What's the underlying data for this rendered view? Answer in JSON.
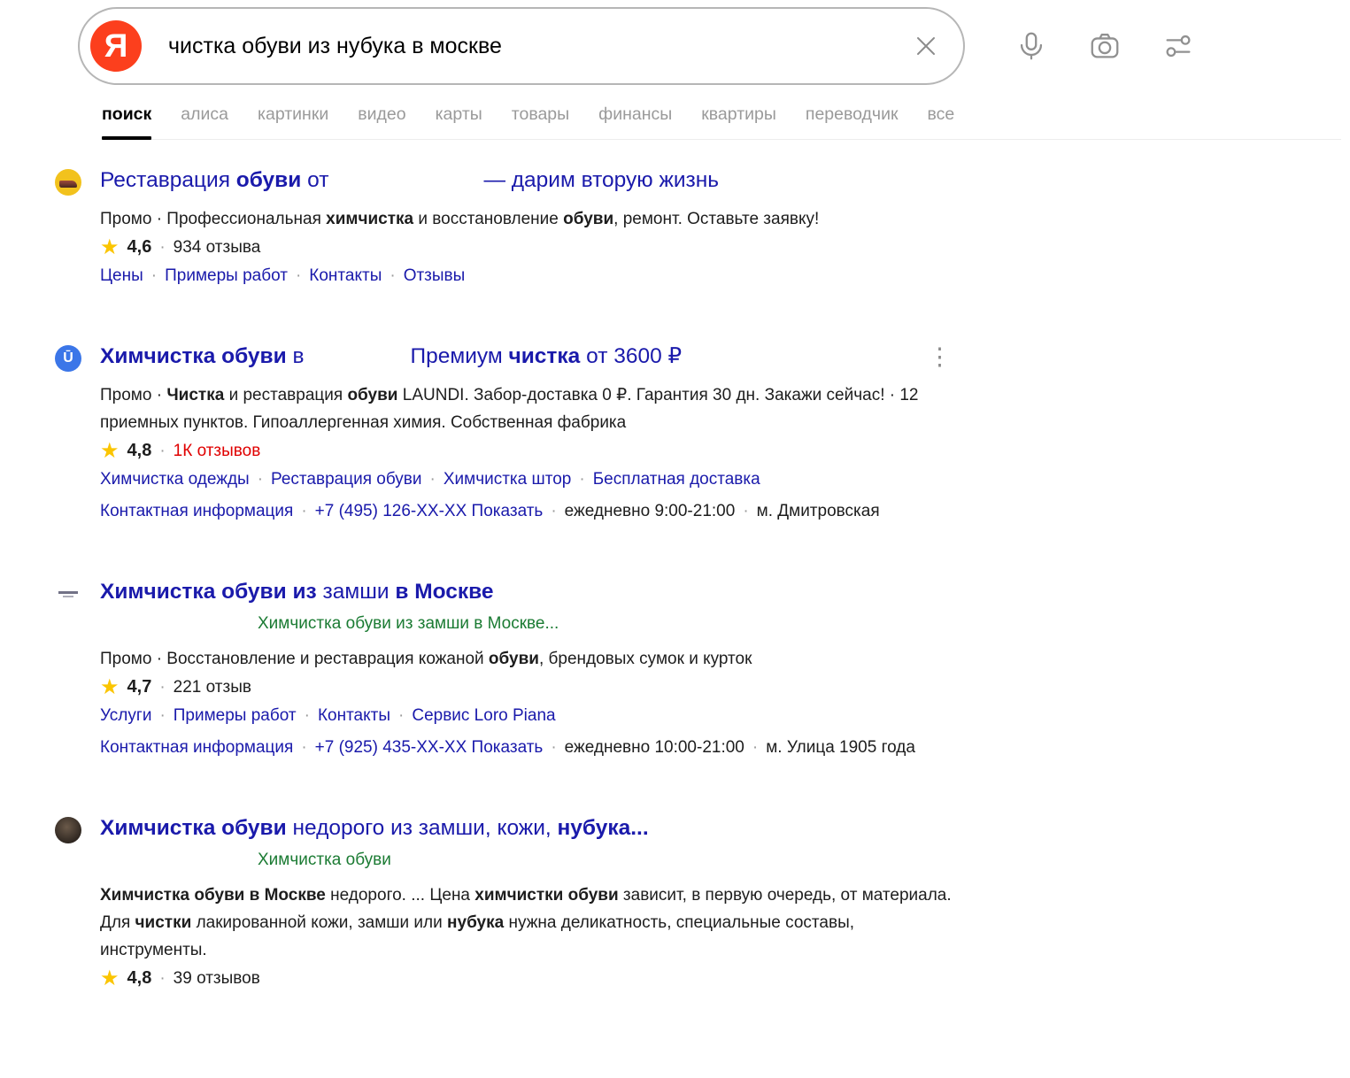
{
  "colors": {
    "accent_red": "#fc3f1d",
    "title_blue": "#1a1aab",
    "breadcrumb_green": "#1b7b33",
    "review_red": "#e00000",
    "star_yellow": "#fbc500"
  },
  "search_bar": {
    "logo_letter": "Я",
    "query": "чистка обуви из нубука в москве",
    "icons": [
      "clear-icon",
      "mic-icon",
      "camera-icon",
      "filters-icon"
    ]
  },
  "tabs": [
    {
      "id": "poisk",
      "label": "поиск",
      "active": true
    },
    {
      "id": "alisa",
      "label": "алиса"
    },
    {
      "id": "kartinki",
      "label": "картинки"
    },
    {
      "id": "video",
      "label": "видео"
    },
    {
      "id": "karty",
      "label": "карты"
    },
    {
      "id": "tovary",
      "label": "товары"
    },
    {
      "id": "finansy",
      "label": "финансы"
    },
    {
      "id": "kvartiry",
      "label": "квартиры"
    },
    {
      "id": "perevodchik",
      "label": "переводчик"
    },
    {
      "id": "vse",
      "label": "все"
    }
  ],
  "results": [
    {
      "favicon": {
        "cls": "fav-restorer",
        "name": "shoe-restoration-favicon-icon"
      },
      "title": [
        {
          "t": "Реставрация "
        },
        {
          "t": "обуви",
          "b": true
        },
        {
          "t": " от"
        },
        {
          "gap": 175
        },
        {
          "t": "— дарим вторую жизнь"
        }
      ],
      "snippet": [
        {
          "t": "Промо · Профессиональная "
        },
        {
          "t": "химчистка",
          "b": true
        },
        {
          "t": " и восстановление "
        },
        {
          "t": "обуви",
          "b": true
        },
        {
          "t": ", ремонт. Оставьте заявку!"
        }
      ],
      "rating": {
        "value": "4,6",
        "count": "934 отзыва",
        "count_red": false
      },
      "link_rows": [
        [
          {
            "t": "Цены",
            "link": true
          },
          {
            "t": "Примеры работ",
            "link": true
          },
          {
            "t": "Контакты",
            "link": true
          },
          {
            "t": "Отзывы",
            "link": true
          }
        ]
      ],
      "menu": false
    },
    {
      "favicon": {
        "cls": "fav-laundi",
        "name": "laundi-logo-favicon-icon",
        "letter": "Ū"
      },
      "title": [
        {
          "t": "Химчистка обуви",
          "b": true
        },
        {
          "t": " в"
        },
        {
          "gap": 120
        },
        {
          "t": "Премиум "
        },
        {
          "t": "чистка",
          "b": true
        },
        {
          "t": " от 3600 ₽"
        }
      ],
      "snippet": [
        {
          "t": "Промо · "
        },
        {
          "t": "Чистка",
          "b": true
        },
        {
          "t": " и реставрация "
        },
        {
          "t": "обуви",
          "b": true
        },
        {
          "t": " LAUNDI. Забор-доставка 0 ₽. Гарантия 30 дн. Закажи сейчас! · 12 приемных пунктов. Гипоаллергенная химия. Собственная фабрика"
        }
      ],
      "rating": {
        "value": "4,8",
        "count": "1К отзывов",
        "count_red": true
      },
      "link_rows": [
        [
          {
            "t": "Химчистка одежды",
            "link": true
          },
          {
            "t": "Реставрация обуви",
            "link": true
          },
          {
            "t": "Химчистка штор",
            "link": true
          },
          {
            "t": "Бесплатная доставка",
            "link": true
          }
        ],
        [
          {
            "t": "Контактная информация",
            "link": true
          },
          {
            "t": "+7 (495) 126-XX-XX Показать",
            "link": true
          },
          {
            "t": "ежедневно 9:00-21:00",
            "link": false
          },
          {
            "t": "м. Дмитровская",
            "link": false
          }
        ]
      ],
      "menu": true
    },
    {
      "favicon": {
        "cls": "fav-textlogo",
        "name": "text-logo-favicon-icon"
      },
      "title": [
        {
          "t": "Химчистка обуви из",
          "b": true
        },
        {
          "t": " замши "
        },
        {
          "t": "в Москве",
          "b": true
        }
      ],
      "breadcrumb": "Химчистка обуви из замши в Москве...",
      "breadcrumb_indent": 178,
      "snippet": [
        {
          "t": "Промо · Восстановление и реставрация кожаной "
        },
        {
          "t": "обуви",
          "b": true
        },
        {
          "t": ", брендовых сумок и курток"
        }
      ],
      "rating": {
        "value": "4,7",
        "count": "221 отзыв",
        "count_red": false
      },
      "link_rows": [
        [
          {
            "t": "Услуги",
            "link": true
          },
          {
            "t": "Примеры работ",
            "link": true
          },
          {
            "t": "Контакты",
            "link": true
          },
          {
            "t": "Сервис Loro Piana",
            "link": true
          }
        ],
        [
          {
            "t": "Контактная информация",
            "link": true
          },
          {
            "t": "+7 (925) 435-XX-XX Показать",
            "link": true
          },
          {
            "t": "ежедневно 10:00-21:00",
            "link": false
          },
          {
            "t": "м. Улица 1905 года",
            "link": false
          }
        ]
      ],
      "menu": false
    },
    {
      "favicon": {
        "cls": "fav-dark",
        "name": "dark-photo-favicon-icon"
      },
      "title": [
        {
          "t": "Химчистка обуви",
          "b": true
        },
        {
          "t": " недорого из замши, кожи, "
        },
        {
          "t": "нубука...",
          "b": true
        }
      ],
      "breadcrumb": "Химчистка обуви",
      "breadcrumb_indent": 178,
      "snippet": [
        {
          "t": "Химчистка обуви в Москве",
          "b": true
        },
        {
          "t": " недорого. ... Цена "
        },
        {
          "t": "химчистки обуви",
          "b": true
        },
        {
          "t": " зависит, в первую очередь, от материала. Для "
        },
        {
          "t": "чистки",
          "b": true
        },
        {
          "t": " лакированной кожи, замши или "
        },
        {
          "t": "нубука",
          "b": true
        },
        {
          "t": " нужна деликатность, специальные составы, инструменты."
        }
      ],
      "rating": {
        "value": "4,8",
        "count": "39 отзывов",
        "count_red": false
      },
      "link_rows": [],
      "menu": false
    }
  ]
}
